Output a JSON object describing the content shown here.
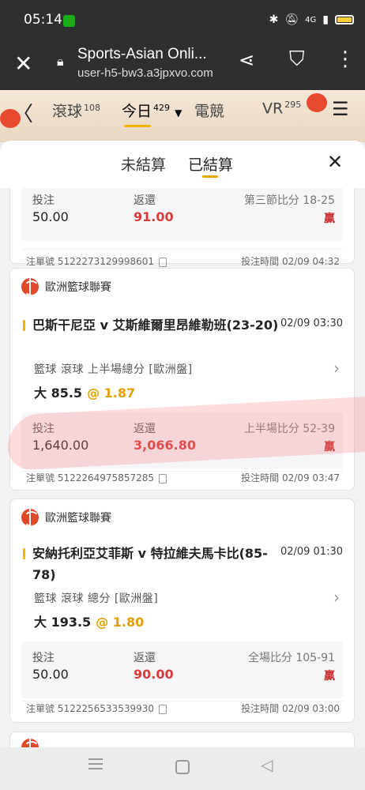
{
  "status_bar": {
    "time": "05:14",
    "network": "4G"
  },
  "browser": {
    "title": "Sports-Asian Onli...",
    "url": "user-h5-bw3.a3jpxvo.com"
  },
  "sports_nav": {
    "tabs": [
      {
        "label": "滾球",
        "count": "108"
      },
      {
        "label": "今日",
        "count": "429"
      },
      {
        "label": "電競",
        "count": ""
      },
      {
        "label": "VR",
        "count": "295"
      }
    ]
  },
  "sheet": {
    "tabs": [
      "未結算",
      "已結算"
    ],
    "active_tab": "已結算"
  },
  "labels": {
    "stake": "投注",
    "return": "返還",
    "order_no": "注單號",
    "bet_time": "投注時間",
    "win": "贏"
  },
  "bets": [
    {
      "stake": "50.00",
      "return": "91.00",
      "score": "第三節比分 18-25",
      "result": "贏",
      "order_no": "5122273129998601",
      "bet_time": "02/09 04:32"
    },
    {
      "league": "歐洲籃球聯賽",
      "match": "巴斯干尼亞 v 艾斯維爾里昂維勒班(23-20)",
      "match_time": "02/09 03:30",
      "market": "籃球  滾球  上半場總分 [歐洲盤]",
      "pick": "大 85.5",
      "odds": "@ 1.87",
      "stake": "1,640.00",
      "return": "3,066.80",
      "score": "上半場比分 52-39",
      "result": "贏",
      "order_no": "5122264975857285",
      "bet_time": "02/09 03:47"
    },
    {
      "league": "歐洲籃球聯賽",
      "match": "安納托利亞艾菲斯 v 特拉維夫馬卡比(85-78)",
      "match_time": "02/09 01:30",
      "market": "籃球  滾球  總分 [歐洲盤]",
      "pick": "大 193.5",
      "odds": "@ 1.80",
      "stake": "50.00",
      "return": "90.00",
      "score": "全場比分 105-91",
      "result": "贏",
      "order_no": "5122256533539930",
      "bet_time": "02/09 03:00"
    }
  ]
}
